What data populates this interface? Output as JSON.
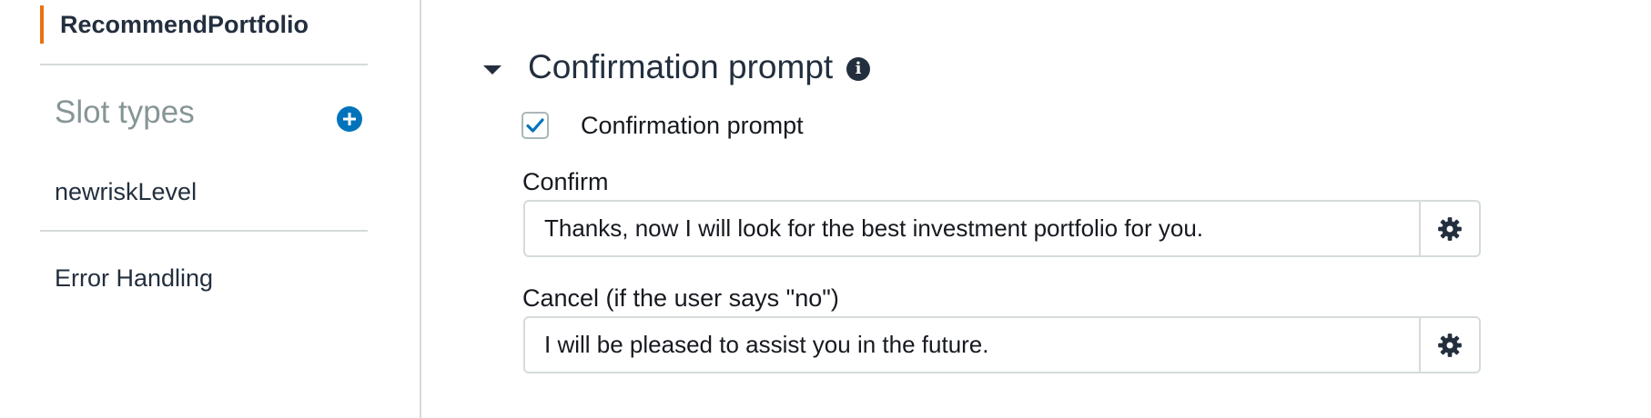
{
  "sidebar": {
    "intent_label": "RecommendPortfolio",
    "slot_types_heading": "Slot types",
    "slot_type_items": [
      {
        "label": "newriskLevel"
      }
    ],
    "error_handling_label": "Error Handling"
  },
  "confirmation": {
    "section_title": "Confirmation prompt",
    "checkbox_label": "Confirmation prompt",
    "checkbox_checked": true,
    "confirm_label": "Confirm",
    "confirm_value": "Thanks, now I will look for the best investment portfolio for you.",
    "cancel_label": "Cancel (if the user says \"no\")",
    "cancel_value": "I will be pleased to assist you in the future."
  },
  "icons": {
    "add": "plus-circle-icon",
    "info": "info-icon",
    "settings": "gear-icon",
    "collapse": "caret-down-icon",
    "check": "checkmark-icon"
  },
  "colors": {
    "accent": "#ec7211",
    "link": "#0073bb",
    "muted": "#879596",
    "border": "#d5dbdb"
  }
}
